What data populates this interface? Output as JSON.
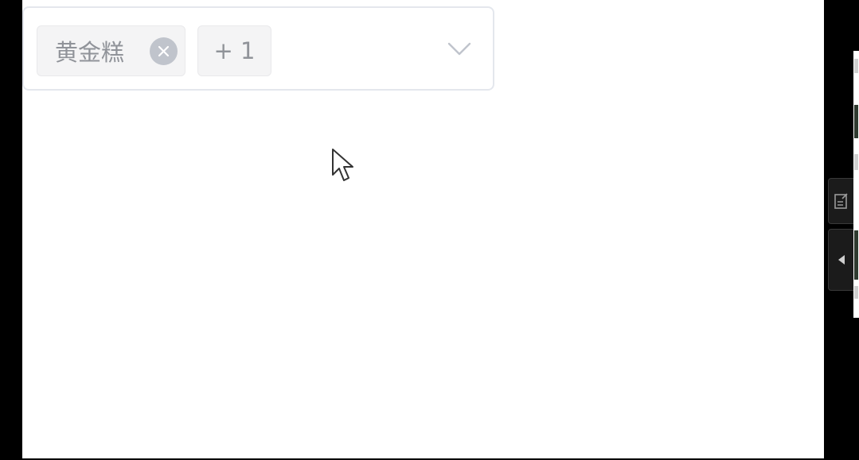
{
  "select": {
    "tags": [
      {
        "label": "黄金糕"
      },
      {
        "label": "+ 1"
      }
    ]
  },
  "colors": {
    "border": "#e4e7ed",
    "tag_bg": "#f4f4f5",
    "tag_text": "#909399",
    "close_bg": "#c0c4cc",
    "chevron": "#c0c4cc",
    "panel_bg": "#1b1b1b"
  },
  "icons": {
    "tag_close": "circle-close-icon",
    "dropdown": "chevron-down-icon",
    "cursor": "mouse-pointer-icon",
    "note": "edit-note-icon",
    "collapse": "caret-left-icon"
  }
}
